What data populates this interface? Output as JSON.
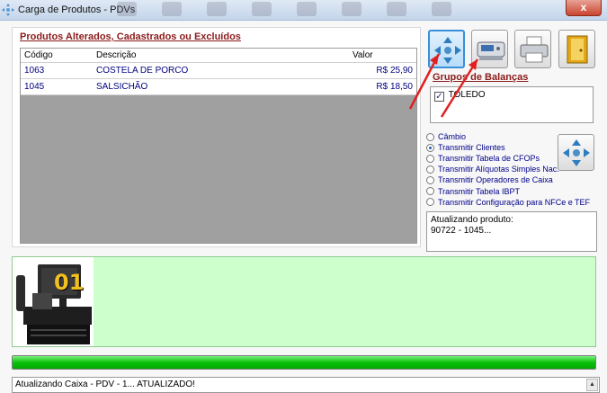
{
  "window": {
    "title": "Carga de Produtos - PDVs",
    "close_label": "x"
  },
  "products": {
    "section_title": "Produtos Alterados, Cadastrados ou Excluídos",
    "columns": [
      "Código",
      "Descrição",
      "Valor"
    ],
    "rows": [
      {
        "code": "1063",
        "description": "COSTELA DE PORCO",
        "value": "R$ 25,90"
      },
      {
        "code": "1045",
        "description": "SALSICHÃO",
        "value": "R$ 18,50"
      }
    ]
  },
  "toolbar": {
    "buttons": [
      {
        "icon": "arrows-transmit-icon",
        "active": true
      },
      {
        "icon": "scale-icon",
        "active": false
      },
      {
        "icon": "printer-icon",
        "active": false
      },
      {
        "icon": "exit-door-icon",
        "active": false
      }
    ]
  },
  "scale_groups": {
    "title": "Grupos de Balanças",
    "items": [
      {
        "label": "TOLEDO",
        "checked": true
      }
    ]
  },
  "options": {
    "selected": "Transmitir Clientes",
    "items": [
      "Câmbio",
      "Transmitir Clientes",
      "Transmitir Tabela de CFOPs",
      "Transmitir Alíquotas Simples Nac.",
      "Transmitir Operadores de Caixa",
      "Transmitir Tabela IBPT",
      "Transmitir Configuração para NFCe e TEF"
    ]
  },
  "status": {
    "line1": "Atualizando produto:",
    "line2": "90722 - 1045..."
  },
  "pdv": {
    "number": "01"
  },
  "progress": {
    "percent": 100
  },
  "log": {
    "text": "Atualizando Caixa - PDV - 1... ATUALIZADO!"
  },
  "colors": {
    "section_title": "#8b1a1a",
    "link_text": "#00008b",
    "green_panel": "#ccffcc",
    "progress": "#09c209",
    "arrow": "#e02020"
  }
}
